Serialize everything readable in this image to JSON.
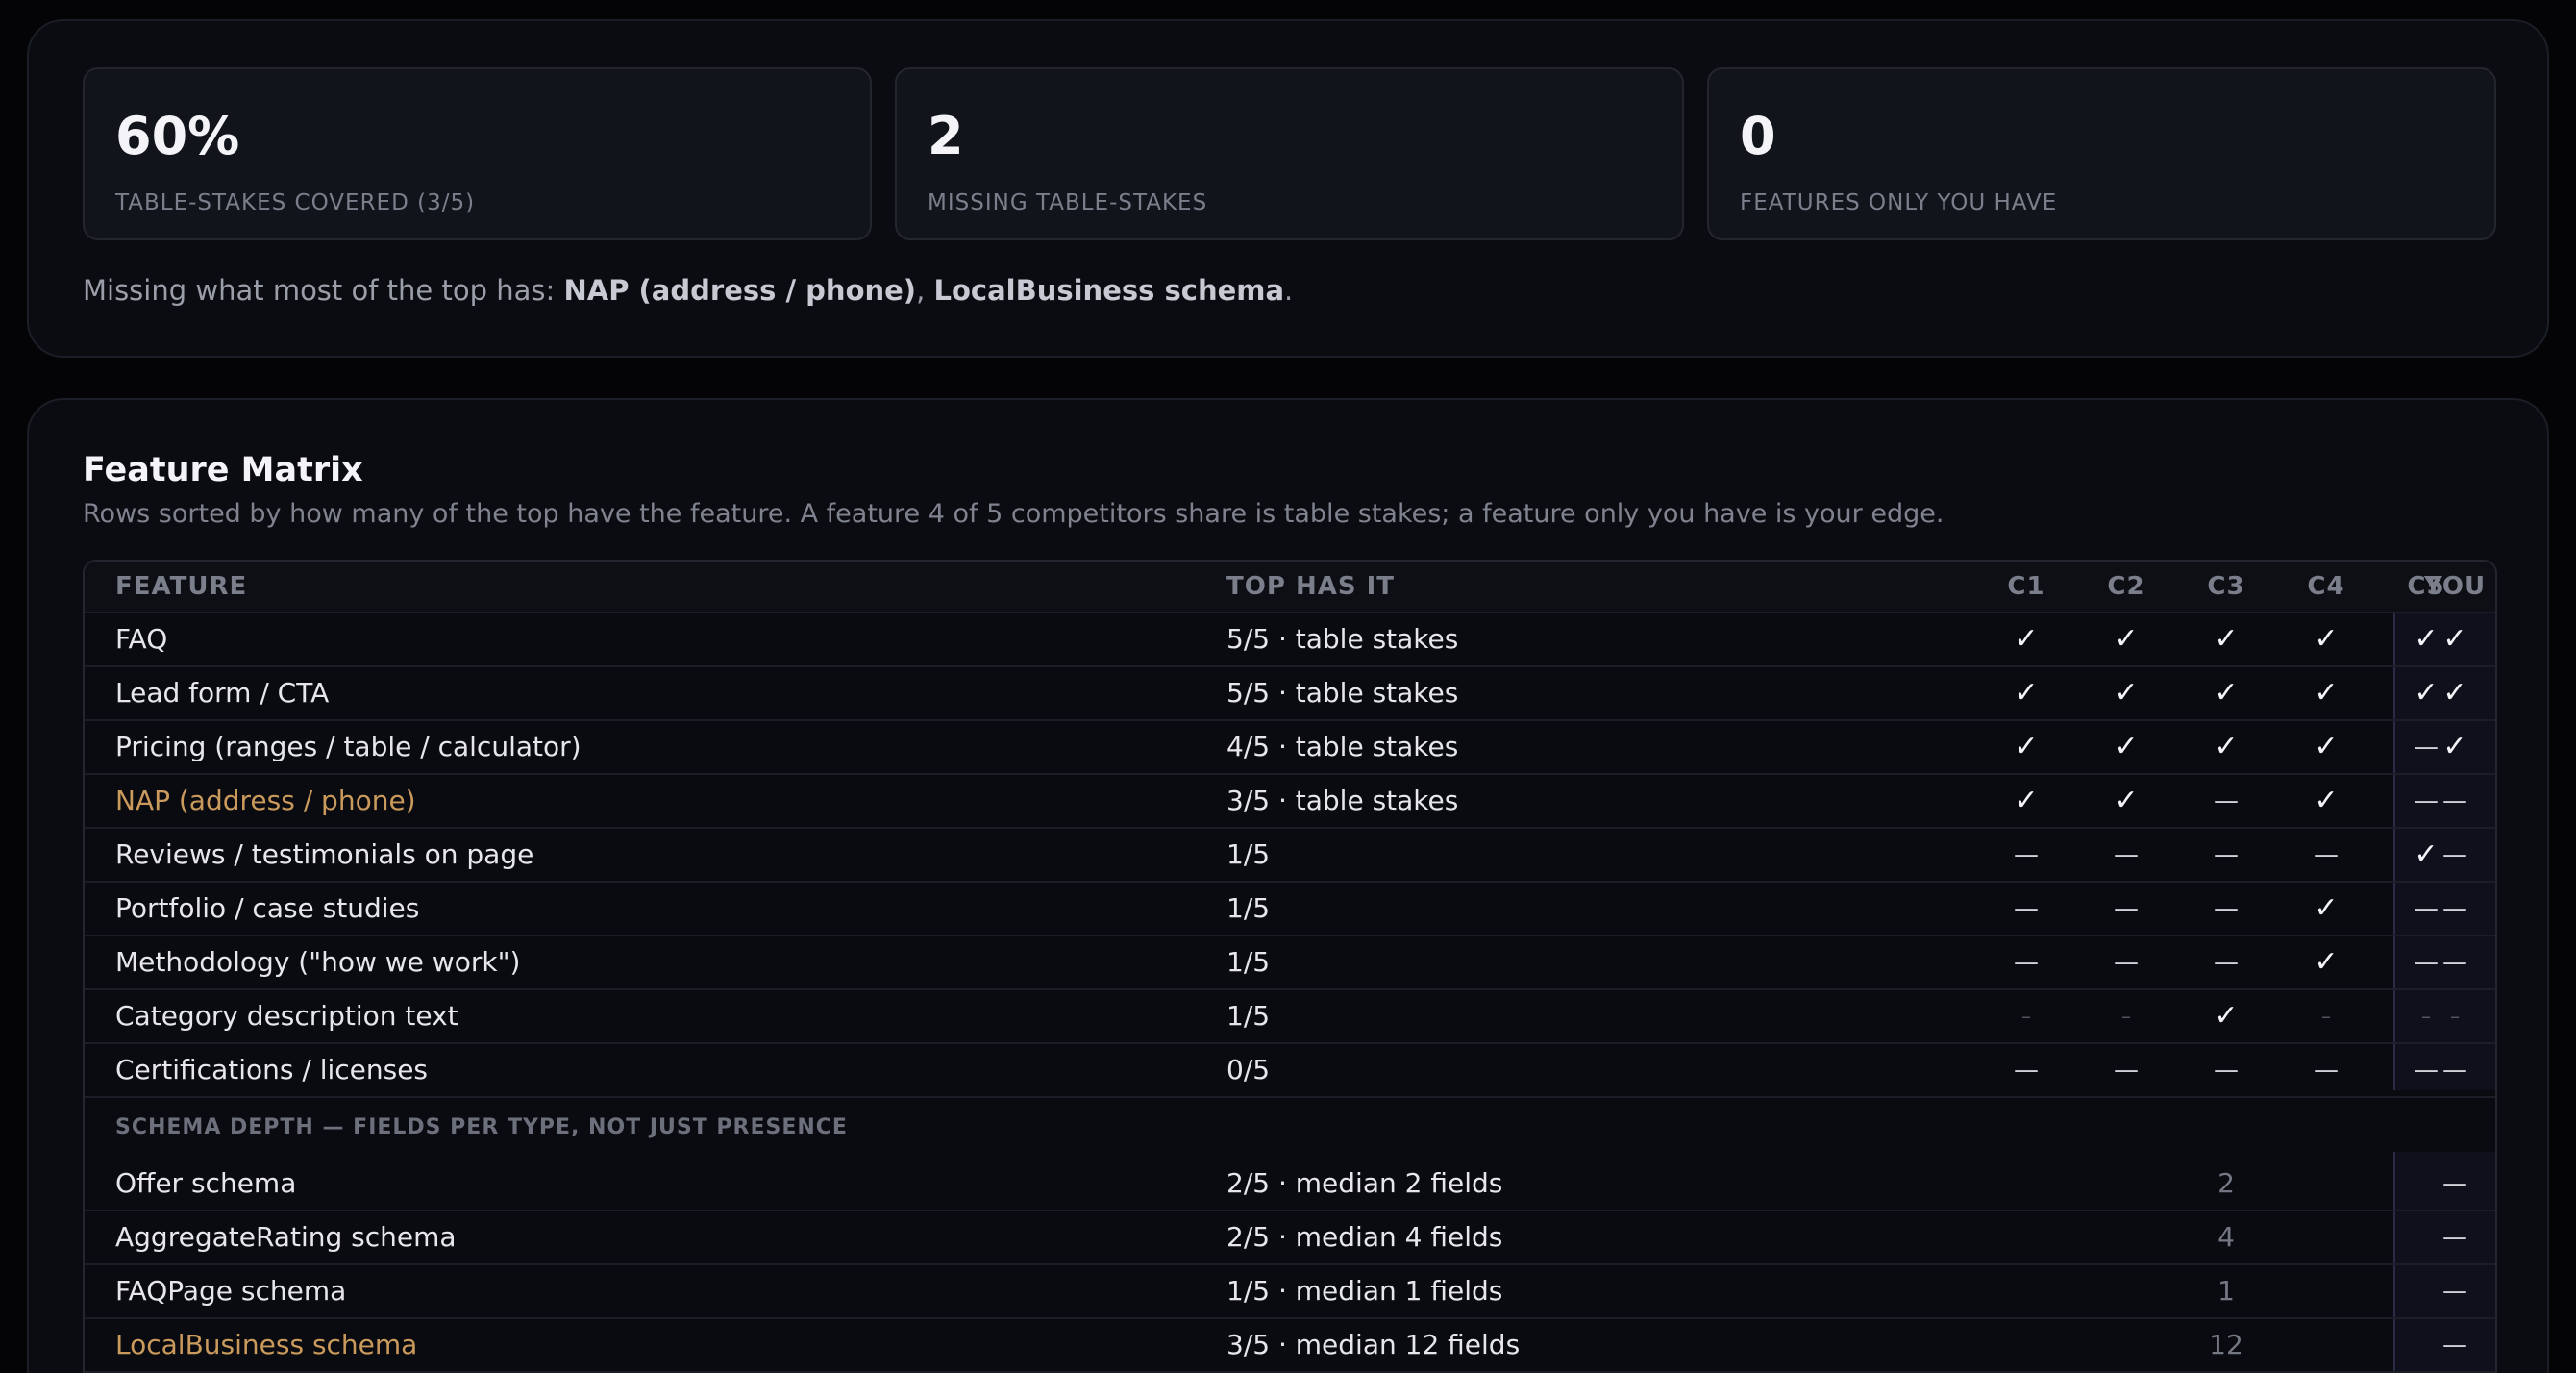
{
  "summary": {
    "cards": [
      {
        "value": "60%",
        "label": "TABLE-STAKES COVERED (3/5)"
      },
      {
        "value": "2",
        "label": "MISSING TABLE-STAKES"
      },
      {
        "value": "0",
        "label": "FEATURES ONLY YOU HAVE"
      }
    ],
    "missing_prefix": "Missing what most of the top has:",
    "missing_items": [
      "NAP (address / phone)",
      "LocalBusiness schema"
    ],
    "missing_separator": ", ",
    "missing_suffix": "."
  },
  "matrix": {
    "title": "Feature Matrix",
    "subtitle": "Rows sorted by how many of the top have the feature. A feature 4 of 5 competitors share is table stakes; a feature only you have is your edge.",
    "headers": {
      "feature": "FEATURE",
      "top": "TOP HAS IT",
      "columns": [
        "C1",
        "C2",
        "C3",
        "C4",
        "C5",
        "YOU"
      ]
    },
    "rows": [
      {
        "feature": "FAQ",
        "top": "5/5 · table stakes",
        "missing": false,
        "cells": [
          "✓",
          "✓",
          "✓",
          "✓",
          "✓",
          "✓"
        ]
      },
      {
        "feature": "Lead form / CTA",
        "top": "5/5 · table stakes",
        "missing": false,
        "cells": [
          "✓",
          "✓",
          "✓",
          "✓",
          "✓",
          "✓"
        ]
      },
      {
        "feature": "Pricing (ranges / table / calculator)",
        "top": "4/5 · table stakes",
        "missing": false,
        "cells": [
          "✓",
          "✓",
          "✓",
          "✓",
          "—",
          "✓"
        ]
      },
      {
        "feature": "NAP (address / phone)",
        "top": "3/5 · table stakes",
        "missing": true,
        "cells": [
          "✓",
          "✓",
          "—",
          "✓",
          "—",
          "—"
        ]
      },
      {
        "feature": "Reviews / testimonials on page",
        "top": "1/5",
        "missing": false,
        "cells": [
          "—",
          "—",
          "—",
          "—",
          "✓",
          "—"
        ]
      },
      {
        "feature": "Portfolio / case studies",
        "top": "1/5",
        "missing": false,
        "cells": [
          "—",
          "—",
          "—",
          "✓",
          "—",
          "—"
        ]
      },
      {
        "feature": "Methodology (\"how we work\")",
        "top": "1/5",
        "missing": false,
        "cells": [
          "—",
          "—",
          "—",
          "✓",
          "—",
          "—"
        ]
      },
      {
        "feature": "Category description text",
        "top": "1/5",
        "missing": false,
        "cells": [
          "–",
          "–",
          "✓",
          "–",
          "–",
          "–"
        ],
        "faint": true
      },
      {
        "feature": "Certifications / licenses",
        "top": "0/5",
        "missing": false,
        "cells": [
          "—",
          "—",
          "—",
          "—",
          "—",
          "—"
        ]
      }
    ],
    "schema_section_label": "SCHEMA DEPTH — FIELDS PER TYPE, NOT JUST PRESENCE",
    "schema_rows": [
      {
        "feature": "Offer schema",
        "top": "2/5 · median 2 fields",
        "missing": false,
        "c3": "2",
        "you": "—"
      },
      {
        "feature": "AggregateRating schema",
        "top": "2/5 · median 4 fields",
        "missing": false,
        "c3": "4",
        "you": "—"
      },
      {
        "feature": "FAQPage schema",
        "top": "1/5 · median 1 fields",
        "missing": false,
        "c3": "1",
        "you": "—"
      },
      {
        "feature": "LocalBusiness schema",
        "top": "3/5 · median 12 fields",
        "missing": true,
        "c3": "12",
        "you": "—"
      }
    ]
  }
}
